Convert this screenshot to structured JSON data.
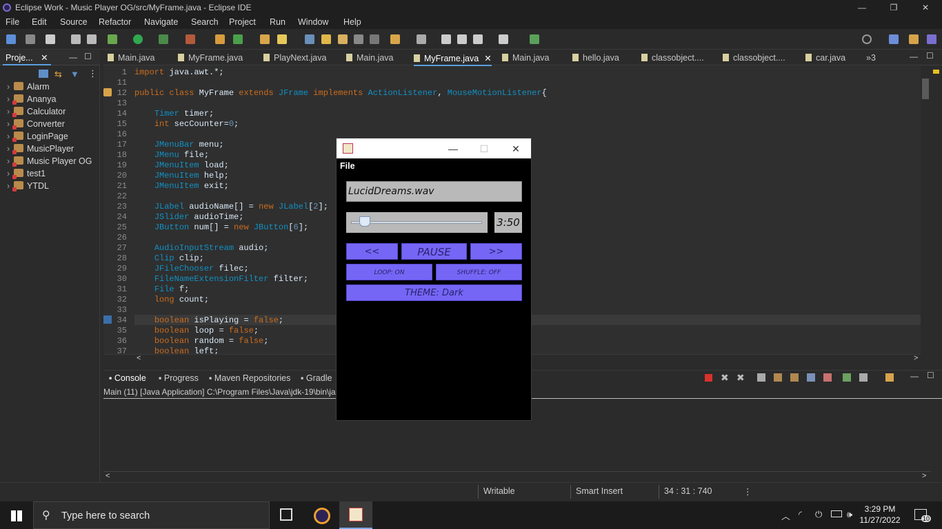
{
  "window": {
    "title": "Eclipse Work - Music Player OG/src/MyFrame.java - Eclipse IDE",
    "minimize": "—",
    "restore": "❐",
    "close": "✕"
  },
  "menu": [
    "File",
    "Edit",
    "Source",
    "Refactor",
    "Navigate",
    "Search",
    "Project",
    "Run",
    "Window",
    "Help"
  ],
  "explorer": {
    "tab": "Proje...",
    "projects": [
      {
        "name": "Alarm",
        "error": false
      },
      {
        "name": "Ananya",
        "error": true
      },
      {
        "name": "Calculator",
        "error": true
      },
      {
        "name": "Converter",
        "error": true
      },
      {
        "name": "LoginPage",
        "error": true
      },
      {
        "name": "MusicPlayer",
        "error": true
      },
      {
        "name": "Music Player OG",
        "error": true
      },
      {
        "name": "test1",
        "error": true
      },
      {
        "name": "YTDL",
        "error": true
      }
    ]
  },
  "editor_tabs": [
    "Main.java",
    "MyFrame.java",
    "PlayNext.java",
    "Main.java",
    "MyFrame.java",
    "Main.java",
    "hello.java",
    "classobject....",
    "classobject....",
    "car.java"
  ],
  "active_tab": "MyFrame.java",
  "overflow_tabs": "»3",
  "code_lines": [
    {
      "n": "1",
      "t": "import java.awt.*;"
    },
    {
      "n": "11",
      "t": ""
    },
    {
      "n": "12",
      "t": "public class MyFrame extends JFrame implements ActionListener, MouseMotionListener{"
    },
    {
      "n": "13",
      "t": ""
    },
    {
      "n": "14",
      "t": "    Timer timer;"
    },
    {
      "n": "15",
      "t": "    int secCounter=0;"
    },
    {
      "n": "16",
      "t": ""
    },
    {
      "n": "17",
      "t": "    JMenuBar menu;"
    },
    {
      "n": "18",
      "t": "    JMenu file;"
    },
    {
      "n": "19",
      "t": "    JMenuItem load;"
    },
    {
      "n": "20",
      "t": "    JMenuItem help;"
    },
    {
      "n": "21",
      "t": "    JMenuItem exit;"
    },
    {
      "n": "22",
      "t": ""
    },
    {
      "n": "23",
      "t": "    JLabel audioName[] = new JLabel[2];"
    },
    {
      "n": "24",
      "t": "    JSlider audioTime;"
    },
    {
      "n": "25",
      "t": "    JButton num[] = new JButton[6];"
    },
    {
      "n": "26",
      "t": ""
    },
    {
      "n": "27",
      "t": "    AudioInputStream audio;"
    },
    {
      "n": "28",
      "t": "    Clip clip;"
    },
    {
      "n": "29",
      "t": "    JFileChooser filec;"
    },
    {
      "n": "30",
      "t": "    FileNameExtensionFilter filter;"
    },
    {
      "n": "31",
      "t": "    File f;"
    },
    {
      "n": "32",
      "t": "    long count;"
    },
    {
      "n": "33",
      "t": ""
    },
    {
      "n": "34",
      "t": "    boolean isPlaying = false;"
    },
    {
      "n": "35",
      "t": "    boolean loop = false;"
    },
    {
      "n": "36",
      "t": "    boolean random = false;"
    },
    {
      "n": "37",
      "t": "    boolean left;"
    }
  ],
  "console": {
    "tabs": [
      "Console",
      "Progress",
      "Maven Repositories",
      "Gradle"
    ],
    "path": "Main (11) [Java Application] C:\\Program Files\\Java\\jdk-19\\bin\\ja"
  },
  "status": {
    "mode": "Writable",
    "insert": "Smart Insert",
    "position": "34 : 31 : 740"
  },
  "player": {
    "menu_file": "File",
    "song": "LucidDreams.wav",
    "time": "3:50",
    "progress": 0.1,
    "prev": "<<",
    "pause": "PAUSE",
    "next": ">>",
    "loop": "LOOP: ON",
    "shuffle": "SHUFFLE: OFF",
    "theme": "THEME: Dark",
    "button_color": "#7566f5"
  },
  "taskbar": {
    "search_placeholder": "Type here to search",
    "time": "3:29 PM",
    "date": "11/27/2022",
    "notifications": "10"
  }
}
